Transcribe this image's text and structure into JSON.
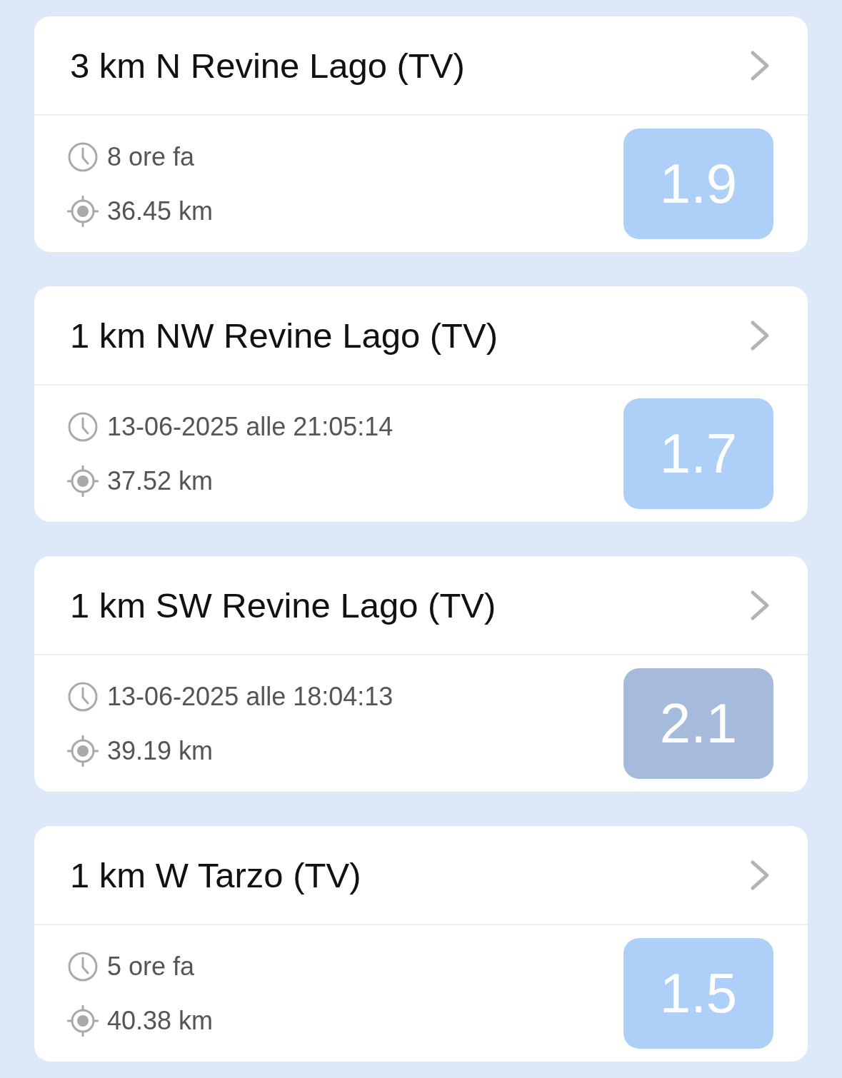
{
  "events": [
    {
      "title": "3 km N Revine Lago (TV)",
      "time": "8 ore fa",
      "distance": "36.45 km",
      "magnitude": "1.9",
      "color": "#aecff7"
    },
    {
      "title": "1 km NW Revine Lago (TV)",
      "time": "13-06-2025 alle 21:05:14",
      "distance": "37.52 km",
      "magnitude": "1.7",
      "color": "#aecff7"
    },
    {
      "title": "1 km SW Revine Lago (TV)",
      "time": "13-06-2025 alle 18:04:13",
      "distance": "39.19 km",
      "magnitude": "2.1",
      "color": "#a6bbdb"
    },
    {
      "title": "1 km W Tarzo (TV)",
      "time": "5 ore fa",
      "distance": "40.38 km",
      "magnitude": "1.5",
      "color": "#aecff7"
    }
  ]
}
